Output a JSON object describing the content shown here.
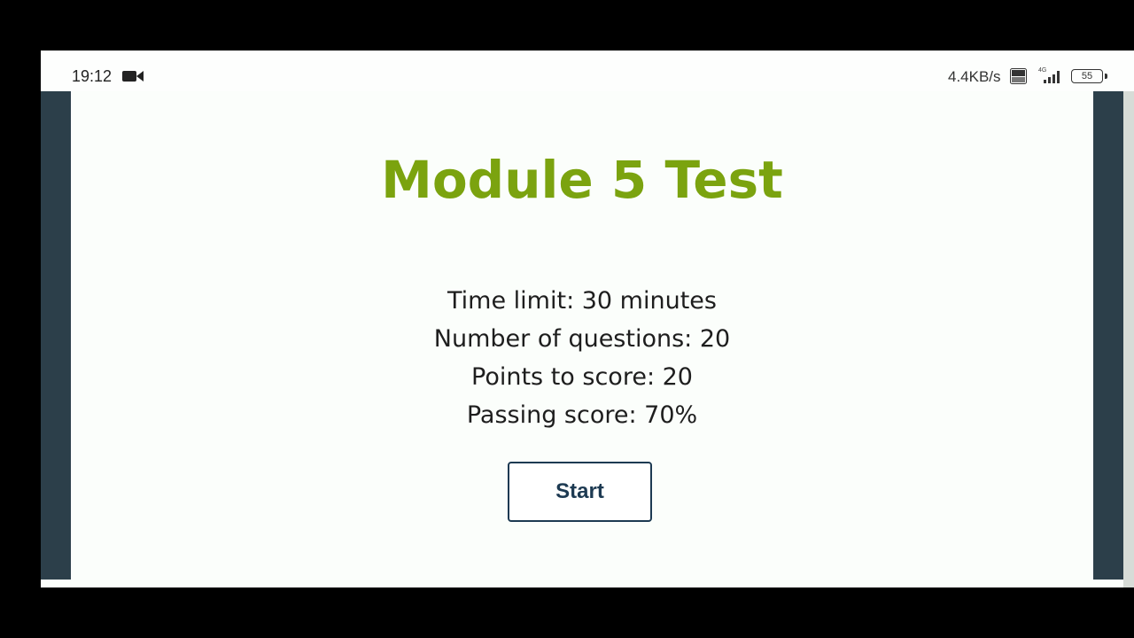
{
  "status_bar": {
    "time": "19:12",
    "net_speed": "4.4KB/s",
    "volte_label": "Vo LTE",
    "network_type": "4G",
    "battery": "55",
    "icons": [
      "video-camera-icon",
      "volte-icon",
      "signal-icon",
      "battery-icon"
    ]
  },
  "test": {
    "title": "Module 5 Test",
    "info": [
      "Time limit: 30 minutes",
      "Number of questions: 20",
      "Points to score: 20",
      "Passing score: 70%"
    ],
    "start_label": "Start"
  },
  "colors": {
    "title": "#7ba30f",
    "side_bars": "#2c3f4a",
    "button_border": "#1d3a52",
    "background": "#fbfefb"
  }
}
